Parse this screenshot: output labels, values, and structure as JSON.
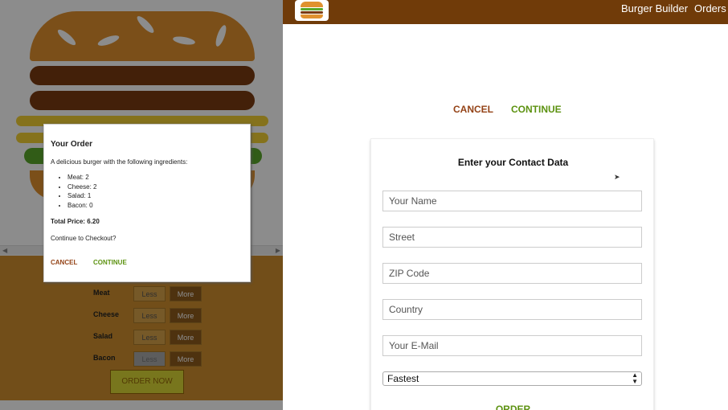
{
  "left": {
    "modal": {
      "title": "Your Order",
      "description": "A delicious burger with the following ingredients:",
      "ingredients": [
        {
          "text": "Meat: 2"
        },
        {
          "text": "Cheese: 2"
        },
        {
          "text": "Salad: 1"
        },
        {
          "text": "Bacon: 0"
        }
      ],
      "price_text": "Total Price: 6.20",
      "question": "Continue to Checkout?",
      "cancel_label": "CANCEL",
      "continue_label": "CONTINUE"
    },
    "controls": [
      {
        "label": "Meat",
        "less": "Less",
        "more": "More"
      },
      {
        "label": "Cheese",
        "less": "Less",
        "more": "More"
      },
      {
        "label": "Salad",
        "less": "Less",
        "more": "More"
      },
      {
        "label": "Bacon",
        "less": "Less",
        "more": "More"
      }
    ],
    "order_now": "ORDER NOW"
  },
  "right": {
    "toolbar": {
      "nav": [
        "Burger Builder",
        "Orders"
      ]
    },
    "actions": {
      "cancel_label": "CANCEL",
      "continue_label": "CONTINUE"
    },
    "contact": {
      "title": "Enter your Contact Data",
      "fields": [
        {
          "placeholder": "Your Name"
        },
        {
          "placeholder": "Street"
        },
        {
          "placeholder": "ZIP Code"
        },
        {
          "placeholder": "Country"
        },
        {
          "placeholder": "Your E-Mail"
        }
      ],
      "delivery_selected": "Fastest",
      "order_label": "ORDER"
    }
  },
  "colors": {
    "toolbar": "#703b09",
    "cancel": "#944317",
    "continue": "#5c9210",
    "controls_bg": "#cf8f2e"
  }
}
